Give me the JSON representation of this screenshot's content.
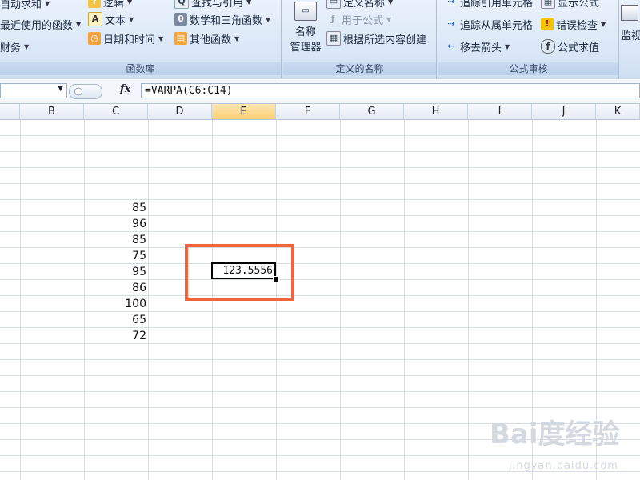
{
  "ribbon": {
    "function_library": {
      "label": "函数库",
      "autosum": "自动求和",
      "recent": "最近使用的函数",
      "financial": "财务",
      "logical": "逻辑",
      "text": "文本",
      "datetime": "日期和时间",
      "lookup": "查找与引用",
      "math": "数学和三角函数",
      "more": "其他函数"
    },
    "defined_names": {
      "label": "定义的名称",
      "name_manager_line1": "名称",
      "name_manager_line2": "管理器",
      "define_name": "定义名称",
      "use_in_formula": "用于公式",
      "create_from_selection": "根据所选内容创建"
    },
    "formula_auditing": {
      "label": "公式审核",
      "trace_precedents": "追踪引用单元格",
      "trace_dependents": "追踪从属单元格",
      "remove_arrows": "移去箭头",
      "show_formulas": "显示公式",
      "error_checking": "错误检查",
      "evaluate_formula": "公式求值"
    },
    "watch": "监视"
  },
  "formula_bar": {
    "fx_label": "fx",
    "formula": "=VARPA(C6:C14)"
  },
  "columns": [
    "B",
    "C",
    "D",
    "E",
    "F",
    "G",
    "H",
    "I",
    "J",
    "K"
  ],
  "active_column": "E",
  "column_c_values": [
    "85",
    "96",
    "85",
    "75",
    "95",
    "86",
    "100",
    "65",
    "72"
  ],
  "active_cell_value": "123.5556",
  "watermark": {
    "brand": "Bai度经验",
    "site": "jingyan.baidu.com"
  },
  "colors": {
    "highlight": "#f0653a",
    "active_header": "#f9cf74"
  }
}
